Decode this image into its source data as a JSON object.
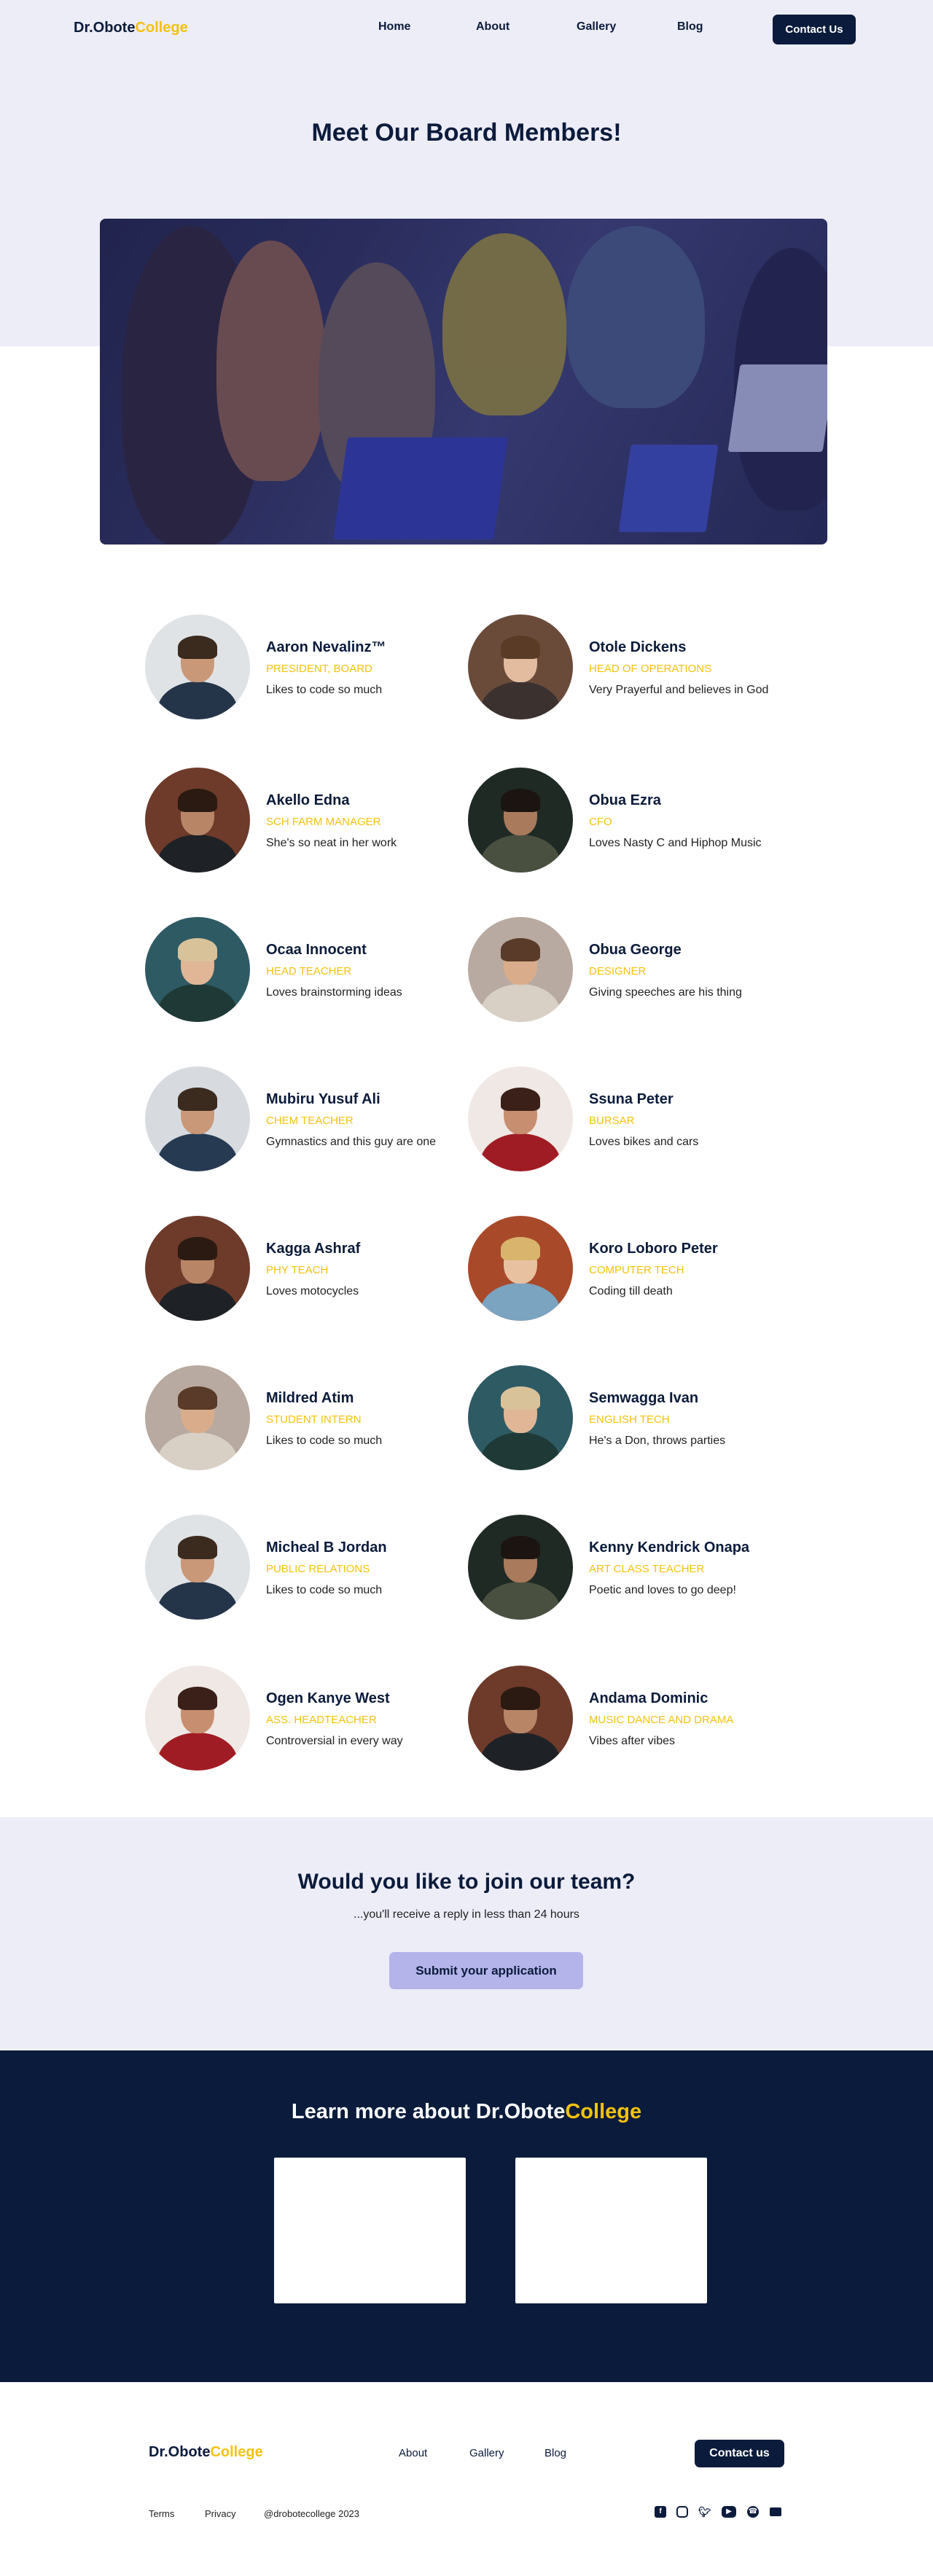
{
  "brand": {
    "name_part1": "Dr.Obote",
    "name_part2": "College"
  },
  "nav": {
    "links": [
      "Home",
      "About",
      "Gallery",
      "Blog"
    ],
    "contact_label": "Contact Us"
  },
  "hero": {
    "title": "Meet Our Board Members!"
  },
  "members": [
    {
      "name": "Aaron Nevalinz™",
      "role": "PRESIDENT, BOARD",
      "bio": "Likes to code so much"
    },
    {
      "name": "Otole Dickens",
      "role": "HEAD OF OPERATIONS",
      "bio": "Very Prayerful and believes in God"
    },
    {
      "name": "Akello Edna",
      "role": "SCH FARM MANAGER",
      "bio": "She's so neat in her work"
    },
    {
      "name": "Obua Ezra",
      "role": "CFO",
      "bio": "Loves Nasty C and Hiphop Music"
    },
    {
      "name": "Ocaa Innocent",
      "role": "HEAD TEACHER",
      "bio": "Loves brainstorming ideas"
    },
    {
      "name": "Obua George",
      "role": "DESIGNER",
      "bio": "Giving speeches are his thing"
    },
    {
      "name": "Mubiru Yusuf Ali",
      "role": "CHEM TEACHER",
      "bio": "Gymnastics and this guy are one"
    },
    {
      "name": "Ssuna Peter",
      "role": "BURSAR",
      "bio": "Loves bikes and cars"
    },
    {
      "name": "Kagga Ashraf",
      "role": "PHY TEACH",
      "bio": "Loves motocycles"
    },
    {
      "name": "Koro Loboro Peter",
      "role": "COMPUTER TECH",
      "bio": "Coding till death"
    },
    {
      "name": "Mildred Atim",
      "role": "STUDENT INTERN",
      "bio": "Likes to code so much"
    },
    {
      "name": "Semwagga Ivan",
      "role": "ENGLISH TECH",
      "bio": "He's a Don, throws parties"
    },
    {
      "name": "Micheal B Jordan",
      "role": "PUBLIC RELATIONS",
      "bio": "Likes to code so much"
    },
    {
      "name": "Kenny Kendrick Onapa",
      "role": "ART CLASS TEACHER",
      "bio": "Poetic and loves to go deep!"
    },
    {
      "name": "Ogen Kanye West",
      "role": "ASS. HEADTEACHER",
      "bio": "Controversial in every way"
    },
    {
      "name": "Andama Dominic",
      "role": "MUSIC DANCE AND DRAMA",
      "bio": "Vibes after vibes"
    }
  ],
  "join": {
    "title": "Would you like to join our team?",
    "subtitle": "...you'll receive a reply in less than 24 hours",
    "button": "Submit your application"
  },
  "learn": {
    "title_prefix": "Learn more about "
  },
  "footer": {
    "links": [
      "About",
      "Gallery",
      "Blog"
    ],
    "contact_label": "Contact us",
    "terms": "Terms",
    "privacy": "Privacy",
    "handle": "@drobotecollege 2023"
  },
  "social_icons": [
    "facebook-icon",
    "instagram-icon",
    "twitter-icon",
    "youtube-icon",
    "whatsapp-icon",
    "email-icon"
  ],
  "colors": {
    "primary": "#0b1b3b",
    "accent": "#f4c20d",
    "light_bg": "#ededf8",
    "button_soft": "#b4b4ea"
  }
}
